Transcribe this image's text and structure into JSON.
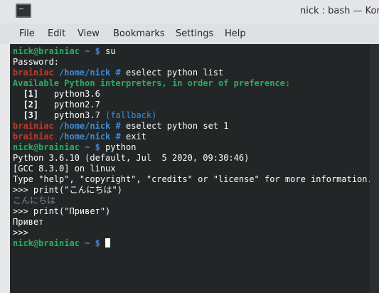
{
  "window": {
    "title": "nick : bash — Kon"
  },
  "menu": {
    "items": [
      "File",
      "Edit",
      "View",
      "Bookmarks",
      "Settings",
      "Help"
    ]
  },
  "terminal": {
    "user_host": "nick@brainiac",
    "root_host": "brainiac",
    "home_dir": "~",
    "nick_dir": "/home/nick",
    "user_sign": "$",
    "root_sign": "#",
    "cmd_su": "su",
    "password_prompt": "Password:",
    "cmd_list": "eselect python list",
    "available_header": "Available Python interpreters, in order of preference:",
    "interpreters": [
      {
        "index": "[1]",
        "name": "python3.6",
        "note": ""
      },
      {
        "index": "[2]",
        "name": "python2.7",
        "note": ""
      },
      {
        "index": "[3]",
        "name": "python3.7",
        "note": "(fallback)"
      }
    ],
    "cmd_set": "eselect python set 1",
    "cmd_exit": "exit",
    "cmd_python": "python",
    "python_version": "Python 3.6.10 (default, Jul  5 2020, 09:30:46)",
    "gcc_line": "[GCC 8.3.0] on linux",
    "help_line": "Type \"help\", \"copyright\", \"credits\" or \"license\" for more information.",
    "repl_1": ">>> print(\"こんにちは\")",
    "output_1": "こんにちは",
    "repl_2": ">>> print(\"Привет\")",
    "output_2": "Привет",
    "repl_3": ">>>"
  }
}
